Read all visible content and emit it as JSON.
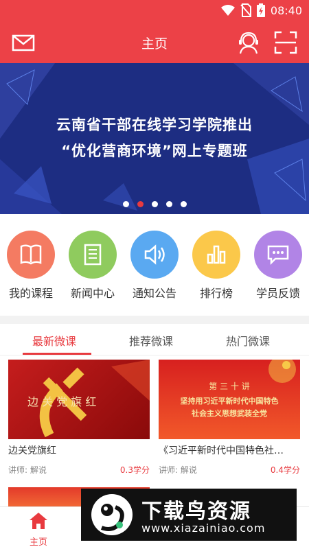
{
  "status_bar": {
    "time": "08:40"
  },
  "header": {
    "title": "主页"
  },
  "banner": {
    "line1": "云南省干部在线学习学院推出",
    "line2": "“优化营商环境”网上专题班",
    "slides": 5,
    "active_slide": 2
  },
  "quick_menu": [
    {
      "label": "我的课程",
      "icon": "book-icon",
      "color": "#f47b62"
    },
    {
      "label": "新闻中心",
      "icon": "news-icon",
      "color": "#8fcb5e"
    },
    {
      "label": "通知公告",
      "icon": "speaker-icon",
      "color": "#5aa9f1"
    },
    {
      "label": "排行榜",
      "icon": "bar-chart-icon",
      "color": "#fbc84a"
    },
    {
      "label": "学员反馈",
      "icon": "chat-icon",
      "color": "#b184e6"
    }
  ],
  "tabs": [
    {
      "label": "最新微课",
      "active": true
    },
    {
      "label": "推荐微课",
      "active": false
    },
    {
      "label": "热门微课",
      "active": false
    }
  ],
  "courses": [
    {
      "title": "边关党旗红",
      "image_text": "边 关 党 旗 红",
      "teacher": "讲师: 解说",
      "credit": "0.3学分"
    },
    {
      "title": "《习近平新时代中国特色社…",
      "image_text_top": "第 三 十 讲",
      "image_text_line1": "坚持用习近平新时代中国特色",
      "image_text_line2": "社会主义思想武装全党",
      "teacher": "讲师: 解说",
      "credit": "0.4学分"
    }
  ],
  "bottom_nav": {
    "home_label": "主页"
  },
  "watermark": {
    "title": "下载鸟资源",
    "url": "www.xiazainiao.com"
  },
  "colors": {
    "primary": "#ec4147",
    "banner_bg": "#1d2d82"
  }
}
